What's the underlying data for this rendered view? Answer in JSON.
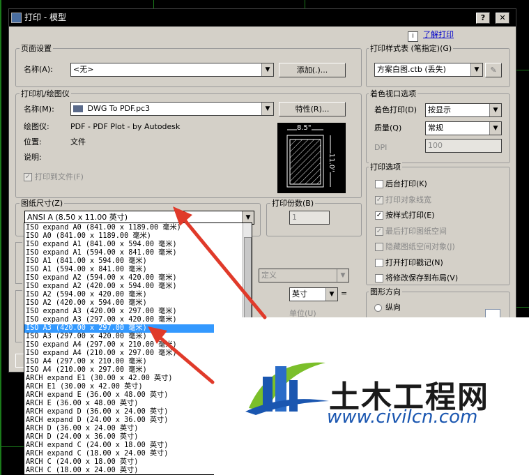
{
  "window": {
    "title": "打印 - 模型",
    "help_btn": "?",
    "close_btn": "✕",
    "learn_link": "了解打印"
  },
  "page_setup": {
    "group_title": "页面设置",
    "name_label": "名称(A):",
    "name_value": "<无>",
    "add_button": "添加(.)..."
  },
  "printer": {
    "group_title": "打印机/绘图仪",
    "name_label": "名称(M):",
    "name_value": "DWG To PDF.pc3",
    "props_button": "特性(R)...",
    "plotter_label": "绘图仪:",
    "plotter_value": "PDF - PDF Plot - by Autodesk",
    "location_label": "位置:",
    "location_value": "文件",
    "desc_label": "说明:",
    "print_to_file": "打印到文件(F)",
    "preview_width": "8.5\"",
    "preview_height": "11.0\""
  },
  "paper_size": {
    "group_title": "图纸尺寸(Z)",
    "selected": "ANSI A (8.50 x 11.00 英寸)",
    "options": [
      "ISO expand A0 (841.00 x 1189.00 毫米)",
      "ISO A0 (841.00 x 1189.00 毫米)",
      "ISO expand A1 (841.00 x 594.00 毫米)",
      "ISO expand A1 (594.00 x 841.00 毫米)",
      "ISO A1 (841.00 x 594.00 毫米)",
      "ISO A1 (594.00 x 841.00 毫米)",
      "ISO expand A2 (594.00 x 420.00 毫米)",
      "ISO expand A2 (420.00 x 594.00 毫米)",
      "ISO A2 (594.00 x 420.00 毫米)",
      "ISO A2 (420.00 x 594.00 毫米)",
      "ISO expand A3 (420.00 x 297.00 毫米)",
      "ISO expand A3 (297.00 x 420.00 毫米)",
      "ISO A3 (420.00 x 297.00 毫米)",
      "ISO A3 (297.00 x 420.00 毫米)",
      "ISO expand A4 (297.00 x 210.00 毫米)",
      "ISO expand A4 (210.00 x 297.00 毫米)",
      "ISO A4 (297.00 x 210.00 毫米)",
      "ISO A4 (210.00 x 297.00 毫米)",
      "ARCH expand E1 (30.00 x 42.00 英寸)",
      "ARCH E1 (30.00 x 42.00 英寸)",
      "ARCH expand E (36.00 x 48.00 英寸)",
      "ARCH E (36.00 x 48.00 英寸)",
      "ARCH expand D (36.00 x 24.00 英寸)",
      "ARCH expand D (24.00 x 36.00 英寸)",
      "ARCH D (36.00 x 24.00 英寸)",
      "ARCH D (24.00 x 36.00 英寸)",
      "ARCH expand C (24.00 x 18.00 英寸)",
      "ARCH expand C (18.00 x 24.00 英寸)",
      "ARCH C (24.00 x 18.00 英寸)",
      "ARCH C (18.00 x 24.00 英寸)"
    ],
    "highlighted_index": 12
  },
  "copies": {
    "group_title": "打印份数(B)",
    "value": "1"
  },
  "partial_hidden": {
    "scale_custom": "定义",
    "unit_value": "英寸",
    "unit_label": "单位(U)",
    "eq": "="
  },
  "style_table": {
    "group_title": "打印样式表 (笔指定)(G)",
    "value": "方案白图.ctb (丢失)"
  },
  "shaded": {
    "group_title": "着色视口选项",
    "shade_label": "着色打印(D)",
    "shade_value": "按显示",
    "quality_label": "质量(Q)",
    "quality_value": "常规",
    "dpi_label": "DPI",
    "dpi_value": "100"
  },
  "options": {
    "group_title": "打印选项",
    "items": [
      {
        "label": "后台打印(K)",
        "checked": false,
        "disabled": false
      },
      {
        "label": "打印对象线宽",
        "checked": true,
        "disabled": true
      },
      {
        "label": "按样式打印(E)",
        "checked": true,
        "disabled": false
      },
      {
        "label": "最后打印图纸空间",
        "checked": true,
        "disabled": true
      },
      {
        "label": "隐藏图纸空间对象(J)",
        "checked": false,
        "disabled": true
      },
      {
        "label": "打开打印戳记(N)",
        "checked": false,
        "disabled": false
      },
      {
        "label": "将修改保存到布局(V)",
        "checked": false,
        "disabled": false
      }
    ]
  },
  "orientation": {
    "group_title": "图形方向",
    "portrait": "纵向"
  },
  "watermark": {
    "brand_cn": "土木工程网",
    "brand_url": "www.civilcn.com"
  },
  "colors": {
    "dialog_bg": "#d4d0c8",
    "selection": "#3399ff",
    "arrow_red": "#e03a2a",
    "logo_blue": "#1a56b0",
    "logo_green": "#7bbf2a"
  }
}
